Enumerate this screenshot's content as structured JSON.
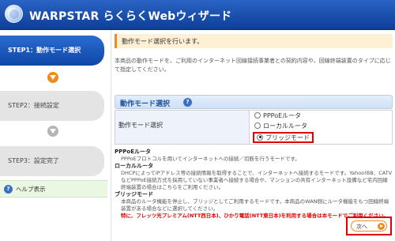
{
  "header": {
    "title": "WARPSTAR らくらくWebウィザード",
    "logo_icon": "warpstar-logo-icon"
  },
  "sidebar": {
    "steps": [
      {
        "label": "STEP1：動作モード選択",
        "state": "active"
      },
      {
        "label": "STEP2：接続設定",
        "state": "inactive"
      },
      {
        "label": "STEP3：設定完了",
        "state": "inactive"
      }
    ],
    "help": {
      "icon": "help-icon",
      "icon_glyph": "?",
      "label": "ヘルプ表示"
    }
  },
  "main": {
    "task": "動作モード選択を行います。",
    "description": "本商品の動作モードを、ご利用のインターネット回線接続事業者との契約内容や、回線終端装置のタイプに応じて指定してください。",
    "section": {
      "title": "動作モード選択",
      "help_glyph": "?"
    },
    "form": {
      "label": "動作モード選択",
      "options": [
        {
          "label": "PPPoEルータ",
          "checked": false
        },
        {
          "label": "ローカルルータ",
          "checked": false
        },
        {
          "label": "ブリッジモード",
          "checked": true
        }
      ]
    },
    "explanations": [
      {
        "term": "PPPoEルータ",
        "text": "PPPoEプロトコルを用いてインターネットへの接続／切断を行うモードです。"
      },
      {
        "term": "ローカルルータ",
        "text": "DHCPによってIPアドレス等の接続情報を取得することで、インターネットへ接続するモードです。Yahoo!BB、CATVなどPPPoE接続方式を採用していない事業者へ接続する場合や、マンションの共有インターネット設備など宅内回線終端装置の場合はこちらをご利用ください。"
      },
      {
        "term": "ブリッジモード",
        "text": "本商品のルータ機能を停止し、ブリッジとしてご利用するモードです。本商品のWAN側にルータ機能をもつ回線終端装置がある場合などに選択してください。",
        "warning": "特に、フレッツ光プレミアム(NTT西日本)、ひかり電話(NTT東日本)を利用する場合は本モードでご利用ください。"
      }
    ],
    "next_button": {
      "label": "次へ",
      "icon": "arrow-right-icon"
    }
  },
  "colors": {
    "header": "#0d3f98",
    "active_step": "#1a55b8",
    "accent": "#f08a1c",
    "highlight": "#e00000",
    "help_bg": "#e9f7e3"
  }
}
